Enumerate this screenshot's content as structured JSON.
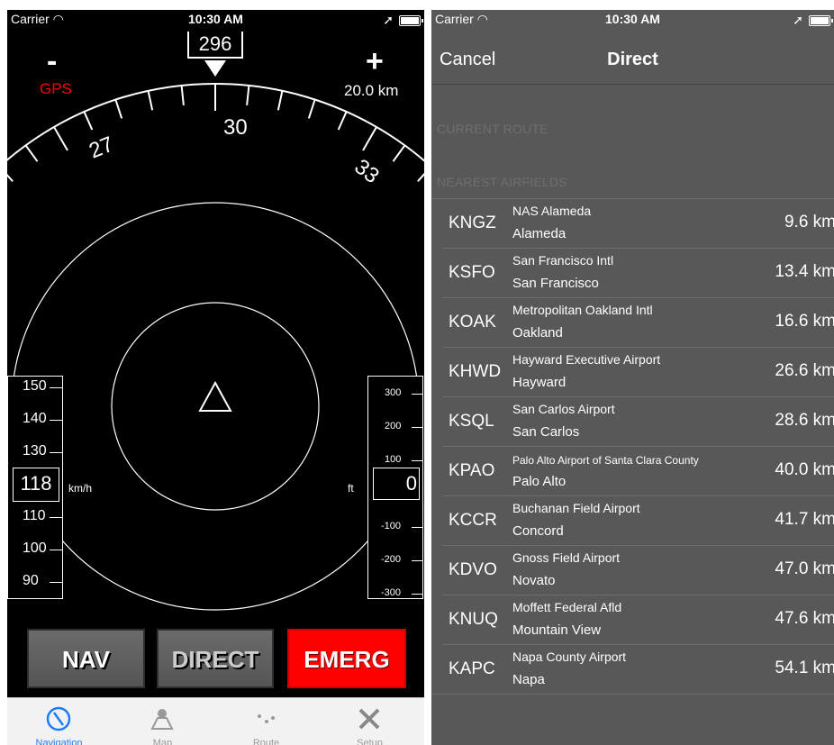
{
  "left_screen": {
    "status": {
      "carrier": "Carrier",
      "time": "10:30 AM"
    },
    "heading": "296",
    "zoom_out_label": "-",
    "zoom_in_label": "+",
    "gps_label": "GPS",
    "range_label": "20.0 km",
    "compass_labels": [
      "27",
      "30",
      "33"
    ],
    "speed_tape": {
      "ticks": [
        "150",
        "140",
        "130",
        "110",
        "100",
        "90"
      ],
      "value": "118",
      "unit": "km/h"
    },
    "alt_tape": {
      "ticks": [
        "300",
        "200",
        "100",
        "-100",
        "-200",
        "-300"
      ],
      "value": "0",
      "unit": "ft"
    },
    "buttons": {
      "nav": "NAV",
      "direct": "DIRECT",
      "emerg": "EMERG"
    },
    "tabs": [
      {
        "label": "Navigation",
        "icon": "compass-icon"
      },
      {
        "label": "Map",
        "icon": "map-icon"
      },
      {
        "label": "Route",
        "icon": "route-icon"
      },
      {
        "label": "Setup",
        "icon": "tools-icon"
      }
    ],
    "colors": {
      "gps": "#ff0000",
      "emerg": "#ff0000",
      "active_tab": "#1e7cf5"
    }
  },
  "right_screen": {
    "status": {
      "carrier": "Carrier",
      "time": "10:30 AM"
    },
    "nav": {
      "cancel": "Cancel",
      "title": "Direct"
    },
    "sections": {
      "current_route": "CURRENT ROUTE",
      "nearest_airfields": "NEAREST AIRFIELDS"
    },
    "airfields": [
      {
        "code": "KNGZ",
        "name": "NAS Alameda",
        "city": "Alameda",
        "distance": "9.6 km"
      },
      {
        "code": "KSFO",
        "name": "San Francisco Intl",
        "city": "San Francisco",
        "distance": "13.4 km"
      },
      {
        "code": "KOAK",
        "name": "Metropolitan Oakland Intl",
        "city": "Oakland",
        "distance": "16.6 km"
      },
      {
        "code": "KHWD",
        "name": "Hayward Executive Airport",
        "city": "Hayward",
        "distance": "26.6 km"
      },
      {
        "code": "KSQL",
        "name": "San Carlos Airport",
        "city": "San Carlos",
        "distance": "28.6 km"
      },
      {
        "code": "KPAO",
        "name": "Palo Alto Airport of Santa Clara County",
        "city": "Palo Alto",
        "distance": "40.0 km"
      },
      {
        "code": "KCCR",
        "name": "Buchanan Field Airport",
        "city": "Concord",
        "distance": "41.7 km"
      },
      {
        "code": "KDVO",
        "name": "Gnoss Field Airport",
        "city": "Novato",
        "distance": "47.0 km"
      },
      {
        "code": "KNUQ",
        "name": "Moffett Federal Afld",
        "city": "Mountain View",
        "distance": "47.6 km"
      },
      {
        "code": "KAPC",
        "name": "Napa County Airport",
        "city": "Napa",
        "distance": "54.1 km"
      }
    ]
  }
}
